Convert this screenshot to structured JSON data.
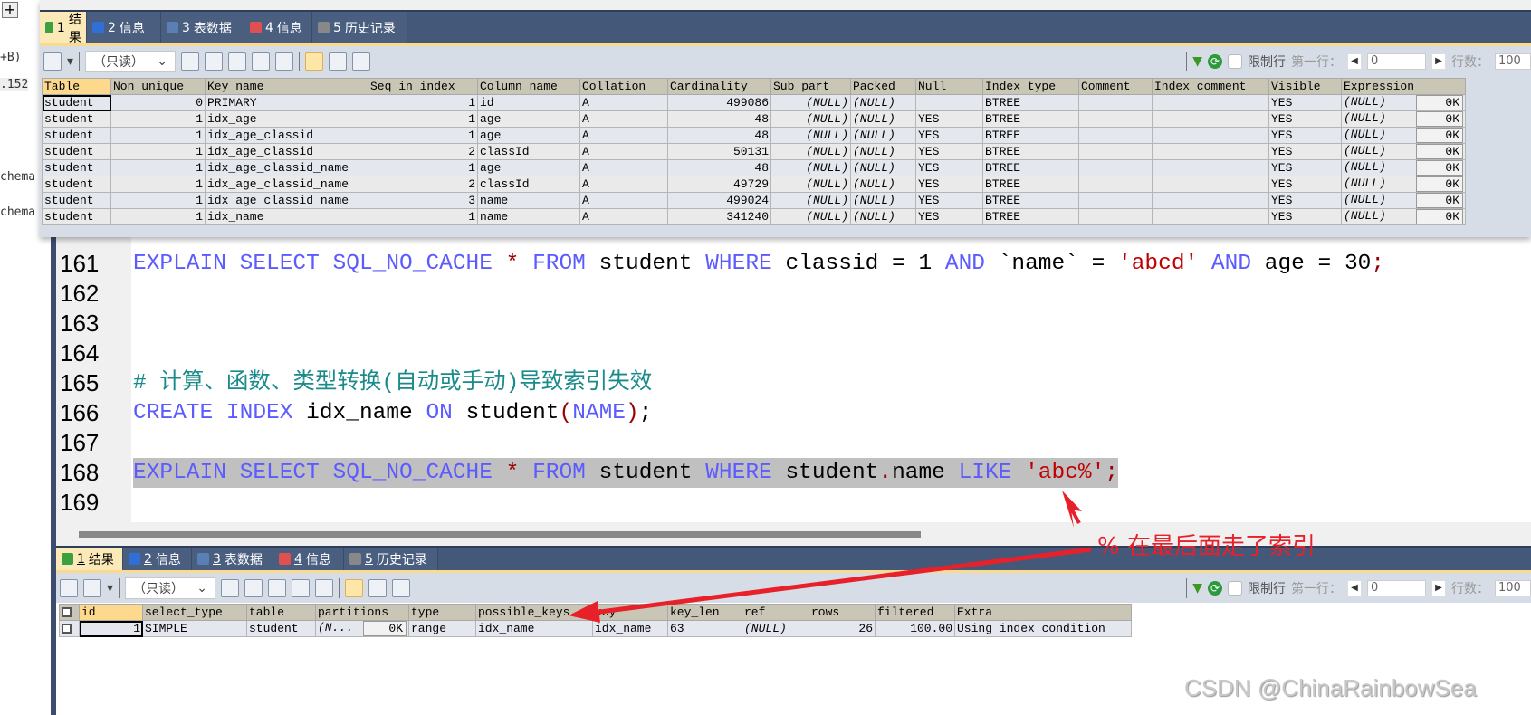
{
  "left_strip": {
    "plus_label": "+",
    "fragments": [
      "+B)",
      ".152",
      "chema",
      "chema"
    ]
  },
  "tabs": [
    {
      "num": "1",
      "label": "结果",
      "icon": "result-grid-icon"
    },
    {
      "num": "2",
      "label": "信息",
      "icon": "info-icon"
    },
    {
      "num": "3",
      "label": "表数据",
      "icon": "table-data-icon"
    },
    {
      "num": "4",
      "label": "信息",
      "icon": "info-chart-icon"
    },
    {
      "num": "5",
      "label": "历史记录",
      "icon": "calendar-icon"
    }
  ],
  "toolbar": {
    "mode": "（只读）",
    "limit_label": "限制行",
    "first_row_label": "第一行：",
    "first_row_value": "0",
    "rows_label": "行数：",
    "rows_value": "100"
  },
  "top_table": {
    "columns": [
      "Table",
      "Non_unique",
      "Key_name",
      "Seq_in_index",
      "Column_name",
      "Collation",
      "Cardinality",
      "Sub_part",
      "Packed",
      "Null",
      "Index_type",
      "Comment",
      "Index_comment",
      "Visible",
      "Expression"
    ],
    "rows": [
      [
        "student",
        "0",
        "PRIMARY",
        "1",
        "id",
        "A",
        "499086",
        "(NULL)",
        "(NULL)",
        "",
        "BTREE",
        "",
        "",
        "YES",
        "(NULL)"
      ],
      [
        "student",
        "1",
        "idx_age",
        "1",
        "age",
        "A",
        "48",
        "(NULL)",
        "(NULL)",
        "YES",
        "BTREE",
        "",
        "",
        "YES",
        "(NULL)"
      ],
      [
        "student",
        "1",
        "idx_age_classid",
        "1",
        "age",
        "A",
        "48",
        "(NULL)",
        "(NULL)",
        "YES",
        "BTREE",
        "",
        "",
        "YES",
        "(NULL)"
      ],
      [
        "student",
        "1",
        "idx_age_classid",
        "2",
        "classId",
        "A",
        "50131",
        "(NULL)",
        "(NULL)",
        "YES",
        "BTREE",
        "",
        "",
        "YES",
        "(NULL)"
      ],
      [
        "student",
        "1",
        "idx_age_classid_name",
        "1",
        "age",
        "A",
        "48",
        "(NULL)",
        "(NULL)",
        "YES",
        "BTREE",
        "",
        "",
        "YES",
        "(NULL)"
      ],
      [
        "student",
        "1",
        "idx_age_classid_name",
        "2",
        "classId",
        "A",
        "49729",
        "(NULL)",
        "(NULL)",
        "YES",
        "BTREE",
        "",
        "",
        "YES",
        "(NULL)"
      ],
      [
        "student",
        "1",
        "idx_age_classid_name",
        "3",
        "name",
        "A",
        "499024",
        "(NULL)",
        "(NULL)",
        "YES",
        "BTREE",
        "",
        "",
        "YES",
        "(NULL)"
      ],
      [
        "student",
        "1",
        "idx_name",
        "1",
        "name",
        "A",
        "341240",
        "(NULL)",
        "(NULL)",
        "YES",
        "BTREE",
        "",
        "",
        "YES",
        "(NULL)"
      ]
    ],
    "blob_label": "0K"
  },
  "code_lines": [
    {
      "n": "161",
      "tokens": [
        [
          "EXPLAIN SELECT SQL_NO_CACHE ",
          "kw"
        ],
        [
          "*",
          "op"
        ],
        [
          " FROM ",
          "kw"
        ],
        [
          "student ",
          "id"
        ],
        [
          "WHERE ",
          "kw"
        ],
        [
          "classid = 1 ",
          "id"
        ],
        [
          "AND ",
          "kw"
        ],
        [
          "`name` = ",
          "id"
        ],
        [
          "'abcd'",
          "str"
        ],
        [
          " AND ",
          "kw"
        ],
        [
          "age = 30",
          "id"
        ],
        [
          ";",
          "op"
        ]
      ]
    },
    {
      "n": "162",
      "tokens": []
    },
    {
      "n": "163",
      "tokens": []
    },
    {
      "n": "164",
      "tokens": []
    },
    {
      "n": "165",
      "tokens": [
        [
          "# 计算、函数、类型转换(自动或手动)导致索引失效",
          "cm"
        ]
      ]
    },
    {
      "n": "166",
      "tokens": [
        [
          "CREATE INDEX ",
          "kw"
        ],
        [
          "idx_name ",
          "id"
        ],
        [
          "ON ",
          "kw"
        ],
        [
          "student",
          "id"
        ],
        [
          "(",
          "op"
        ],
        [
          "NAME",
          "kw"
        ],
        [
          ")",
          "op"
        ],
        [
          ";",
          "id"
        ]
      ]
    },
    {
      "n": "167",
      "tokens": []
    },
    {
      "n": "168",
      "selected": true,
      "tokens": [
        [
          "EXPLAIN SELECT SQL_NO_CACHE ",
          "kw"
        ],
        [
          "*",
          "op"
        ],
        [
          " FROM ",
          "kw"
        ],
        [
          "student ",
          "id"
        ],
        [
          "WHERE ",
          "kw"
        ],
        [
          "student",
          "id"
        ],
        [
          ".",
          "op"
        ],
        [
          "name ",
          "id"
        ],
        [
          "LIKE ",
          "kw"
        ],
        [
          "'abc%'",
          "str"
        ],
        [
          ";",
          "op"
        ]
      ]
    },
    {
      "n": "169",
      "tokens": []
    }
  ],
  "bottom_table": {
    "columns": [
      "id",
      "select_type",
      "table",
      "partitions",
      "type",
      "possible_keys",
      "key",
      "key_len",
      "ref",
      "rows",
      "filtered",
      "Extra"
    ],
    "rows": [
      [
        "1",
        "SIMPLE",
        "student",
        "(N...",
        "range",
        "idx_name",
        "idx_name",
        "63",
        "(NULL)",
        "26",
        "100.00",
        "Using index condition"
      ]
    ],
    "blob_label": "0K"
  },
  "annotation": "% 在最后面走了索引",
  "watermark": "CSDN @ChinaRainbowSea",
  "colors": {
    "tab_bar": "#44587a",
    "active_tab": "#fbe9b8",
    "annotation": "#e8202a",
    "keyword": "#5b5bff",
    "string": "#c00000",
    "comment": "#1a8a8a"
  }
}
